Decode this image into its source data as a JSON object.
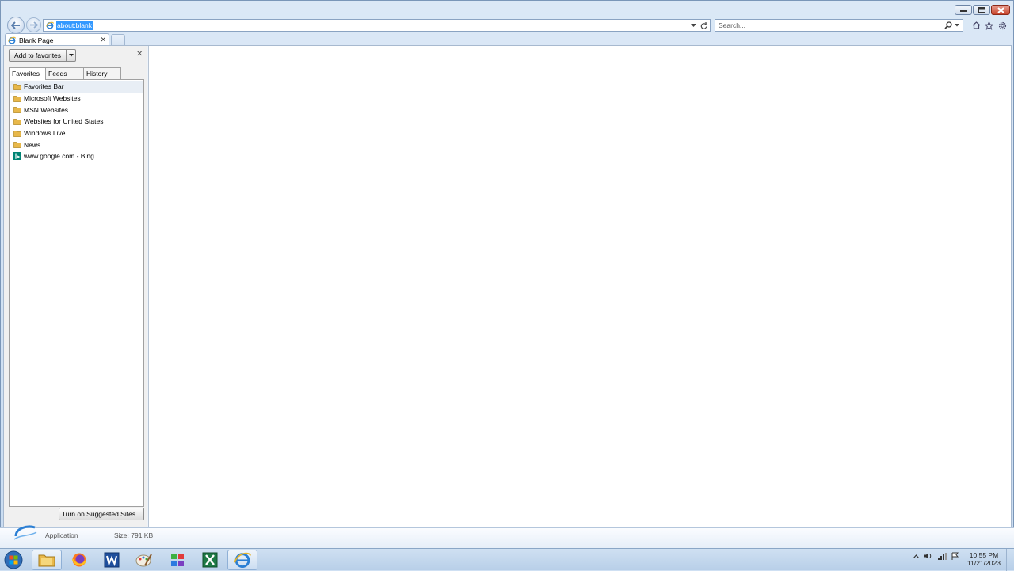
{
  "address": {
    "url": "about:blank"
  },
  "search": {
    "placeholder": "Search..."
  },
  "tab": {
    "title": "Blank Page"
  },
  "favorites_center": {
    "add_button": "Add to favorites",
    "tabs": [
      "Favorites",
      "Feeds",
      "History"
    ],
    "items": [
      {
        "label": "Favorites Bar",
        "icon": "folder-icon"
      },
      {
        "label": "Microsoft Websites",
        "icon": "folder-icon"
      },
      {
        "label": "MSN Websites",
        "icon": "folder-icon"
      },
      {
        "label": "Websites for United States",
        "icon": "folder-icon"
      },
      {
        "label": "Windows Live",
        "icon": "folder-icon"
      },
      {
        "label": "News",
        "icon": "folder-icon"
      },
      {
        "label": "www.google.com - Bing",
        "icon": "bing-icon"
      }
    ],
    "suggested_button": "Turn on Suggested Sites..."
  },
  "details": {
    "type": "Application",
    "size": "Size: 791 KB"
  },
  "taskbar": {
    "apps": [
      "file-explorer-icon",
      "firefox-icon",
      "word-icon",
      "paint-icon",
      "network-icon",
      "excel-icon",
      "internet-explorer-icon"
    ],
    "time": "10:55 PM",
    "date": "11/21/2023"
  },
  "colors": {
    "selection": "#3399ff",
    "accent": "#1e6fd9",
    "folder": "#e8b84a",
    "bing": "#008373",
    "excel": "#1d7a45",
    "word": "#1e4e9c"
  }
}
